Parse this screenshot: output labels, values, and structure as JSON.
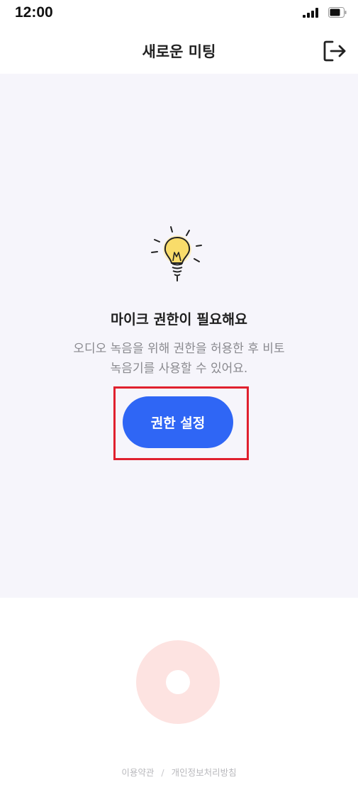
{
  "status_bar": {
    "time": "12:00"
  },
  "header": {
    "title": "새로운 미팅",
    "exit_icon": "exit-icon"
  },
  "permission": {
    "icon": "lightbulb-icon",
    "title": "마이크 권한이 필요해요",
    "description_lines": [
      "오디오 녹음을 위해 권한을 허용한 후 비토",
      "녹음기를 사용할 수 있어요."
    ],
    "button_label": "권한 설정"
  },
  "recorder": {
    "icon": "record-icon"
  },
  "footer": {
    "terms_label": "이용약관",
    "separator": "/",
    "privacy_label": "개인정보처리방침"
  },
  "colors": {
    "accent": "#2f66f5",
    "background_main": "#f6f5fb",
    "record_button": "#fde3e1",
    "highlight": "#e0202e"
  }
}
